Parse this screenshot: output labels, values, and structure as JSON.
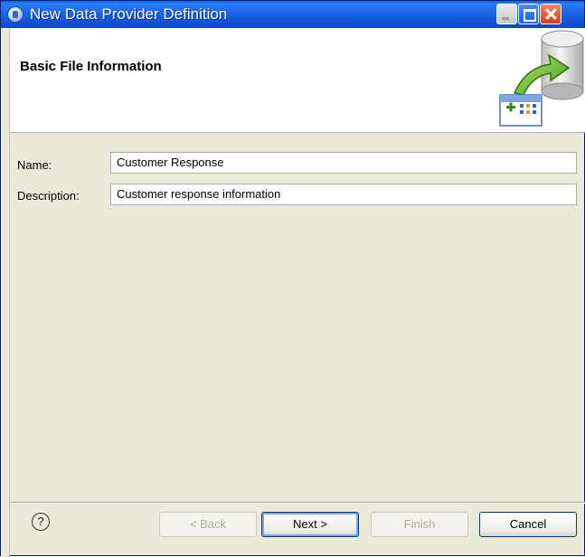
{
  "window": {
    "title": "New Data Provider Definition"
  },
  "banner": {
    "title": "Basic File Information"
  },
  "form": {
    "name_label": "Name:",
    "name_value": "Customer Response",
    "description_label": "Description:",
    "description_value": "Customer response information"
  },
  "buttons": {
    "help": "?",
    "back": "< Back",
    "next": "Next >",
    "finish": "Finish",
    "cancel": "Cancel"
  },
  "colors": {
    "titlebar": "#0b4fd6",
    "dialog_bg": "#ece9d8",
    "banner_bg": "#ffffff"
  }
}
